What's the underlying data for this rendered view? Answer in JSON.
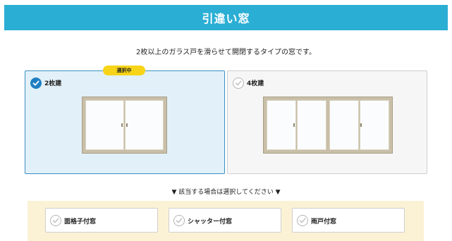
{
  "header": {
    "title": "引違い窓"
  },
  "description": "2枚以上のガラス戸を滑らせて開閉するタイプの窓です。",
  "options": [
    {
      "label": "2枚建",
      "selected": true,
      "badge": "選択中"
    },
    {
      "label": "4枚建",
      "selected": false
    }
  ],
  "note": "▼ 該当する場合は選択してください ▼",
  "extras": [
    {
      "label": "面格子付窓"
    },
    {
      "label": "シャッター付窓"
    },
    {
      "label": "雨戸付窓"
    }
  ],
  "colors": {
    "header": "#2aaed4",
    "selected_border": "#3b8fc2",
    "selected_bg": "#e2f1f9",
    "badge": "#f7d417",
    "extras_bg": "#fbf2d6",
    "check": "#1f7fc2"
  }
}
